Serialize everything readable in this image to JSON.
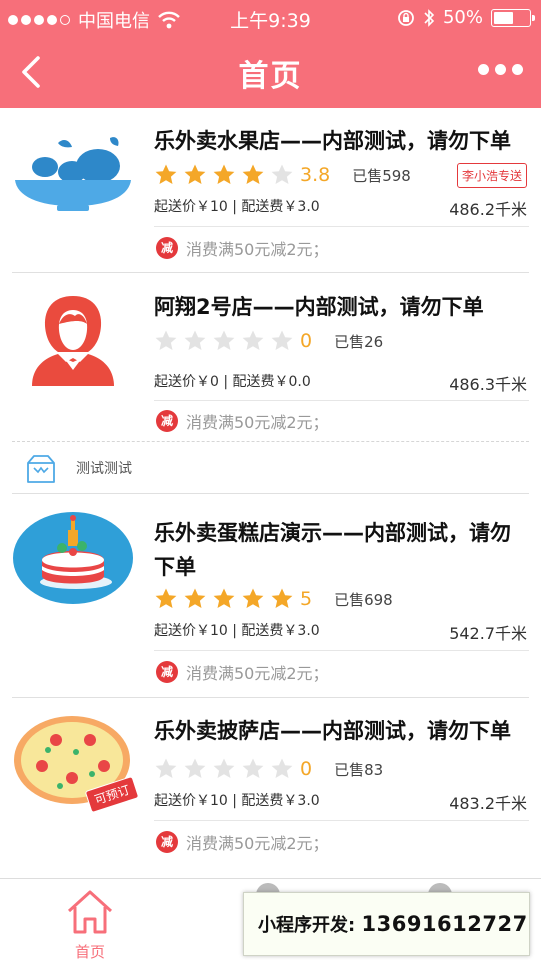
{
  "status_bar": {
    "carrier": "中国电信",
    "time": "上午9:39",
    "battery": "50%",
    "battery_level": 0.5
  },
  "nav": {
    "title": "首页"
  },
  "shops": [
    {
      "name": "乐外卖水果店——内部测试，请勿下单",
      "rating": 3.8,
      "score_text": "3.8",
      "sold": "已售598",
      "fees": "起送价￥10 | 配送费￥3.0",
      "distance": "486.2千米",
      "promo_badge": "减",
      "promo": "消费满50元减2元；"
    },
    {
      "name": "阿翔2号店——内部测试，请勿下单",
      "rating": 0,
      "score_text": "0",
      "sold": "已售26",
      "delivery_tag": "李小浩专送",
      "fees": "起送价￥0 | 配送费￥0.0",
      "distance": "486.3千米",
      "promo_badge": "减",
      "promo": "消费满50元减2元；"
    },
    {
      "name": "乐外卖蛋糕店演示——内部测试，请勿下单",
      "name_line1": "乐外卖蛋糕店演示——内部测试，请勿",
      "name_line2": "下单",
      "rating": 5,
      "score_text": "5",
      "sold": "已售698",
      "fees": "起送价￥10 | 配送费￥3.0",
      "distance": "542.7千米",
      "promo_badge": "减",
      "promo": "消费满50元减2元；"
    },
    {
      "name": "乐外卖披萨店——内部测试，请勿下单",
      "rating": 0,
      "score_text": "0",
      "sold": "已售83",
      "preorder": "可预订",
      "fees": "起送价￥10 | 配送费￥3.0",
      "distance": "483.2千米",
      "promo_badge": "减",
      "promo": "消费满50元减2元；"
    }
  ],
  "category": {
    "label": "测试测试"
  },
  "tabbar": {
    "home_label": "首页"
  },
  "ad_overlay": {
    "label": "小程序开发:",
    "phone": "13691612727"
  },
  "colors": {
    "theme": "#f76f7a",
    "star_on": "#f4a728",
    "star_off": "#e3e3e3",
    "promo_red": "#e4393c"
  }
}
